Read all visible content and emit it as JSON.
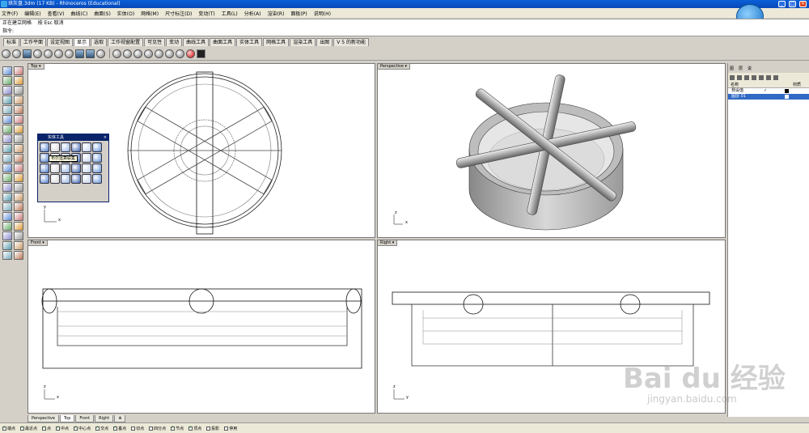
{
  "window": {
    "title": "烘灰盘.3dm (17 KB) - Rhinoceros (Educational)",
    "min": "_",
    "max": "□",
    "close": "×"
  },
  "menu": [
    "文件(F)",
    "编辑(E)",
    "查看(V)",
    "曲线(C)",
    "曲面(S)",
    "实体(O)",
    "网格(M)",
    "尺寸标注(D)",
    "变动(T)",
    "工具(L)",
    "分析(A)",
    "渲染(R)",
    "面板(P)",
    "说明(H)"
  ],
  "command": {
    "line1": "正在建立网格",
    "line2": "按 Esc 取消",
    "prompt": "指令:"
  },
  "tabs": [
    "标准",
    "工作平面",
    "设定视图",
    "显示",
    "选取",
    "工作视窗配置",
    "可见性",
    "变动",
    "曲线工具",
    "曲面工具",
    "实体工具",
    "网格工具",
    "渲染工具",
    "出图",
    "V 5 的新功能"
  ],
  "active_tab_index": 3,
  "viewports": {
    "top": "Top",
    "perspective": "Perspective",
    "front": "Front",
    "right": "Right"
  },
  "solid_tools": {
    "title": "实体工具",
    "close": "×",
    "tooltip": "布尔运算联集"
  },
  "layer_panel": {
    "tabs": [
      "图",
      "层",
      "说"
    ],
    "header_name": "名称",
    "header_material": "材质",
    "rows": [
      {
        "name": "预设值",
        "check": "✓",
        "selected": false
      },
      {
        "name": "图层 01",
        "check": "",
        "selected": true
      }
    ]
  },
  "view_tabs": [
    "Perspective",
    "Top",
    "Front",
    "Right",
    "⊕"
  ],
  "active_view_tab": 1,
  "osnaps": [
    {
      "label": "端点",
      "on": true
    },
    {
      "label": "最近点",
      "on": true
    },
    {
      "label": "点",
      "on": true
    },
    {
      "label": "中点",
      "on": true
    },
    {
      "label": "中心点",
      "on": true
    },
    {
      "label": "交点",
      "on": true
    },
    {
      "label": "垂点",
      "on": true
    },
    {
      "label": "切点",
      "on": false
    },
    {
      "label": "四分点",
      "on": false
    },
    {
      "label": "节点",
      "on": true
    },
    {
      "label": "顶点",
      "on": true
    },
    {
      "label": "投影",
      "on": false
    },
    {
      "label": "停用",
      "on": false
    }
  ],
  "axis": {
    "x": "x",
    "y": "y",
    "z": "z"
  },
  "watermark": {
    "main": "Bai du 经验",
    "sub": "jingyan.baidu.com"
  }
}
